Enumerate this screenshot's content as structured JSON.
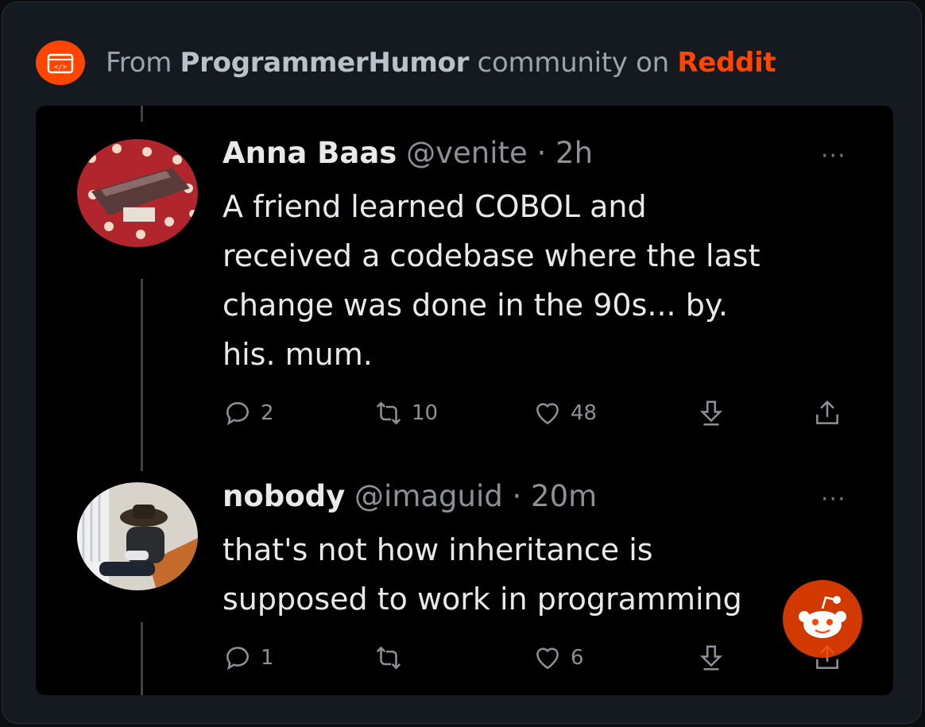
{
  "header": {
    "prefix": "From ",
    "community": "ProgrammerHumor",
    "middle": " community on ",
    "platform": "Reddit"
  },
  "tweets": [
    {
      "name": "Anna Baas",
      "handle": "@venite",
      "time": "· 2h",
      "body": "A friend learned COBOL and\nreceived a codebase where the last\nchange was done in the 90s... by.\nhis. mum.",
      "replies": "2",
      "retweets": "10",
      "likes": "48"
    },
    {
      "name": "nobody",
      "handle": "@imaguid",
      "time": "· 20m",
      "body": "that's not how inheritance is\nsupposed to work in programming",
      "replies": "1",
      "retweets": "",
      "likes": "6"
    }
  ],
  "more_label": "···",
  "colors": {
    "reddit_orange": "#ff4500",
    "card_bg": "#141a1f",
    "tweet_bg": "#000000",
    "text_primary": "#e7e9ea",
    "text_secondary": "#8b9196"
  },
  "icons": [
    "code-community-icon",
    "reply-icon",
    "retweet-icon",
    "like-icon",
    "bookmark-icon",
    "share-icon",
    "reddit-snoo-icon"
  ]
}
